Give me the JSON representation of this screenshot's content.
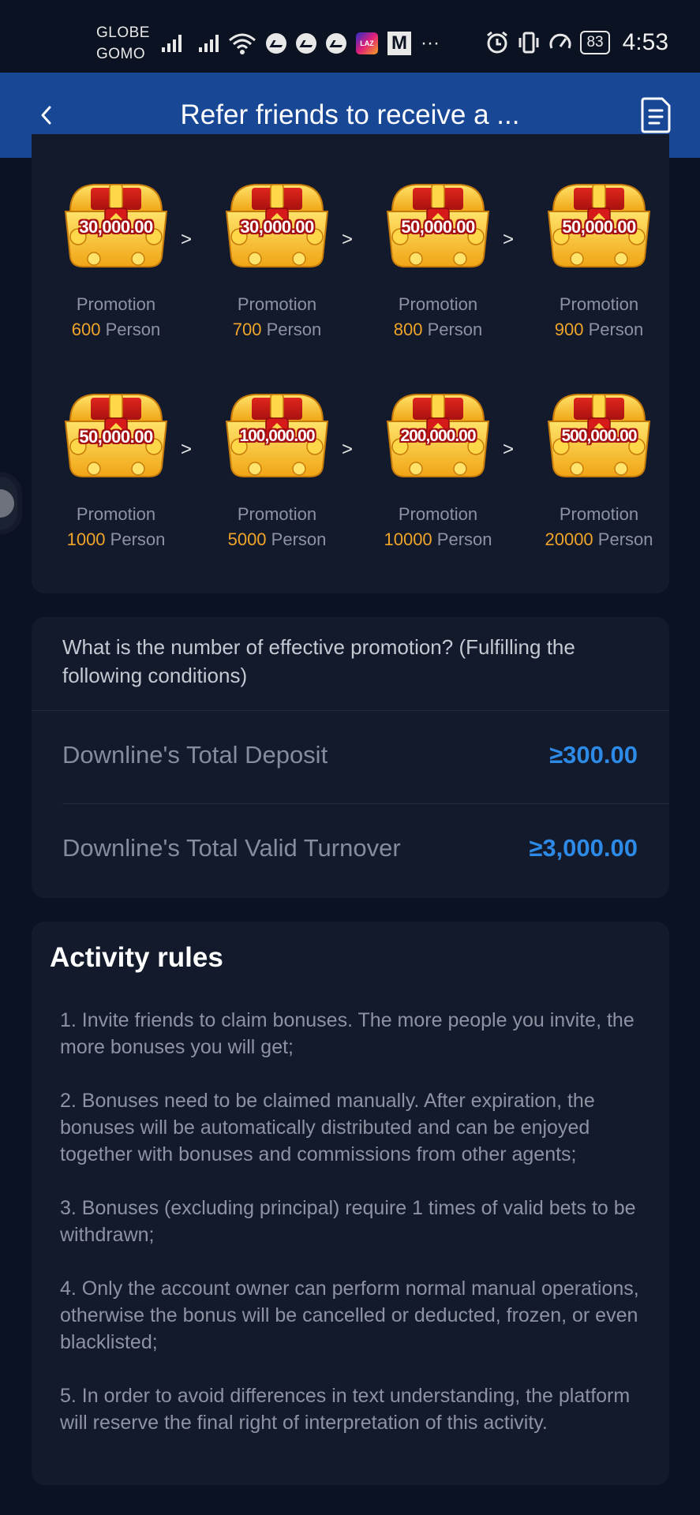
{
  "status_bar": {
    "carrier_line1": "GLOBE",
    "carrier_line2": "GOMO",
    "battery": "83",
    "time": "4:53",
    "more": "···",
    "laz_label": "LAZ",
    "m_label": "M"
  },
  "header": {
    "title": "Refer friends to receive a ...",
    "back_icon": "chevron-left-icon",
    "doc_icon": "document-icon",
    "background": "#184795"
  },
  "rewards": {
    "row1": [
      {
        "amount": "30,000.00",
        "label": "Promotion",
        "count": "600",
        "unit": "Person"
      },
      {
        "amount": "30,000.00",
        "label": "Promotion",
        "count": "700",
        "unit": "Person"
      },
      {
        "amount": "50,000.00",
        "label": "Promotion",
        "count": "800",
        "unit": "Person"
      },
      {
        "amount": "50,000.00",
        "label": "Promotion",
        "count": "900",
        "unit": "Person"
      }
    ],
    "row2": [
      {
        "amount": "50,000.00",
        "label": "Promotion",
        "count": "1000",
        "unit": "Person"
      },
      {
        "amount": "100,000.00",
        "label": "Promotion",
        "count": "5000",
        "unit": "Person"
      },
      {
        "amount": "200,000.00",
        "label": "Promotion",
        "count": "10000",
        "unit": "Person"
      },
      {
        "amount": "500,000.00",
        "label": "Promotion",
        "count": "20000",
        "unit": "Person"
      }
    ],
    "arrow": ">"
  },
  "conditions": {
    "question": "What is the number of effective promotion? (Fulfilling the following conditions)",
    "items": [
      {
        "label": "Downline's Total Deposit",
        "value": "≥300.00"
      },
      {
        "label": "Downline's Total Valid Turnover",
        "value": "≥3,000.00"
      }
    ]
  },
  "rules": {
    "title": "Activity rules",
    "items": [
      "1. Invite friends to claim bonuses. The more people you invite, the more bonuses you will get;",
      "2. Bonuses need to be claimed manually. After expiration, the bonuses will be automatically distributed and can be enjoyed together with bonuses and commissions from other agents;",
      "3. Bonuses (excluding principal) require 1 times of valid bets to be withdrawn;",
      "4. Only the account owner can perform normal manual operations, otherwise the bonus will be cancelled or deducted, frozen, or even blacklisted;",
      "5. In order to avoid differences in text understanding, the platform will reserve the final right of interpretation of this activity."
    ]
  },
  "colors": {
    "accent_blue": "#2d8ae6",
    "accent_orange": "#f0a52a",
    "background": "#0b1222",
    "card": "#121a2c"
  }
}
